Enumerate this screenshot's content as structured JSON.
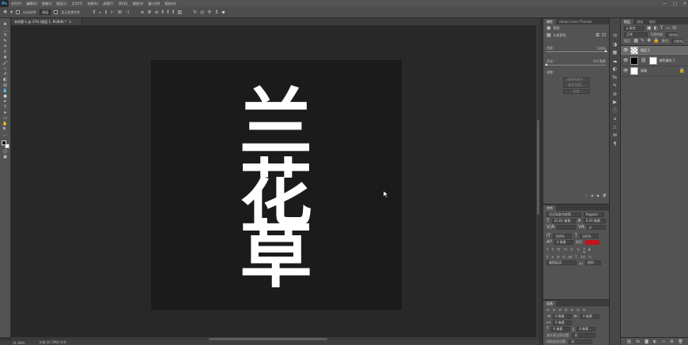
{
  "app": {
    "logo": "Ps"
  },
  "menu": [
    "文件(F)",
    "编辑(E)",
    "图像(I)",
    "图层(L)",
    "文字(Y)",
    "选择(S)",
    "滤镜(T)",
    "3D(D)",
    "视图(V)",
    "窗口(W)",
    "帮助(H)"
  ],
  "window_controls": [
    "—",
    "□",
    "✕"
  ],
  "options": {
    "auto_select": "自动选择:",
    "auto_select_value": "图层",
    "show_transform": "显示变换控件"
  },
  "document": {
    "tab_label": "未标题-1 @ 37% (图层 1, RGB/8) *",
    "close": "×",
    "background_color": "#1b1b1b",
    "text": [
      "兰",
      "花",
      "草"
    ],
    "text_color": "#ffffff"
  },
  "status": {
    "zoom": "31.09%",
    "doc_info": "文档:10.7M/0 字节"
  },
  "properties": {
    "tabs": [
      "属性",
      "Adobe Color Themes"
    ],
    "layer_type": "蒙版",
    "mask_label": "矢量蒙版",
    "density_label": "浓度:",
    "density_value": "100%",
    "feather_label": "羽化:",
    "feather_value": "0.0 像素",
    "adjust_label": "调整:",
    "buttons": [
      "选择并遮住...",
      "颜色范围...",
      "反相"
    ]
  },
  "character": {
    "tab": "字符",
    "font": "方正标准书宋简",
    "style": "Regular",
    "size": "21.61 像素",
    "leading": "0.26 像素",
    "tracking_value": "0",
    "scale_v": "100%",
    "scale_h": "100%",
    "baseline": "0 像素",
    "color_label": "颜色:",
    "color_value": "#c0151a",
    "language": "美国英语",
    "aa_label": "aa",
    "aa_value": "锐利"
  },
  "paragraph": {
    "tab": "段落",
    "indent_left": "0 像素",
    "indent_right": "0 像素",
    "first_line": "0 像素",
    "space_before": "0 像素",
    "space_after": "0 像素",
    "avoid_label": "避头尾法则设置:",
    "avoid_value": "无",
    "spacing_label": "间距组合设置:",
    "spacing_value": "无",
    "hyphenate_label": "连字"
  },
  "layers_panel": {
    "tabs": [
      "图层",
      "通道",
      "路径"
    ],
    "filter_label": "ρ 类型",
    "blend_mode": "正常",
    "opacity_label": "不透明度:",
    "opacity_value": "100%",
    "lock_label": "锁定:",
    "fill_label": "填充:",
    "fill_value": "100%",
    "layers": [
      {
        "name": "图层 1",
        "selected": true
      },
      {
        "name": "颜色填充 1",
        "selected": false
      },
      {
        "name": "背景",
        "selected": false
      }
    ],
    "footer_icons": [
      "⛓",
      "fx",
      "◙",
      "◐",
      "▭",
      "⊞",
      "🗑"
    ]
  }
}
